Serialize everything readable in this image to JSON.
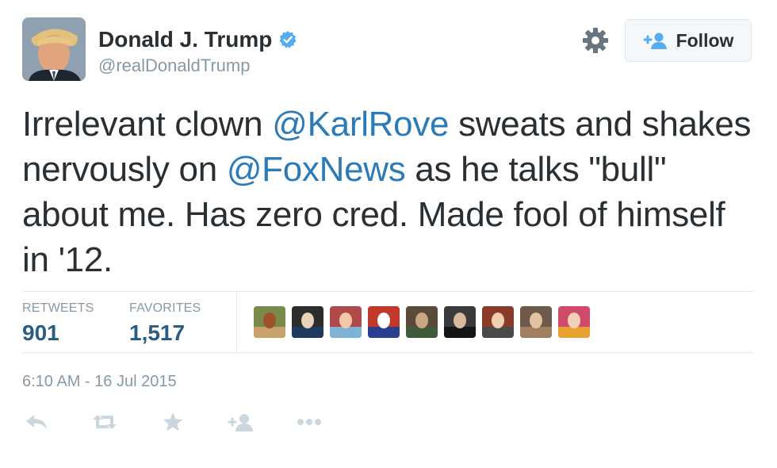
{
  "user": {
    "display_name": "Donald J. Trump",
    "handle": "@realDonaldTrump",
    "verified": true,
    "avatar_icon": "profile-photo"
  },
  "header": {
    "follow_label": "Follow",
    "follow_icon": "add-user-icon",
    "settings_icon": "gear-icon"
  },
  "tweet": {
    "segments": [
      {
        "text": "Irrelevant clown ",
        "type": "text"
      },
      {
        "text": "@KarlRove",
        "type": "mention"
      },
      {
        "text": " sweats and shakes nervously on ",
        "type": "text"
      },
      {
        "text": "@FoxNews",
        "type": "mention"
      },
      {
        "text": " as he talks \"bull\" about me. Has zero cred. Made fool of himself in '12.",
        "type": "text"
      }
    ]
  },
  "stats": {
    "retweets_label": "RETWEETS",
    "retweets_value": "901",
    "favorites_label": "FAVORITES",
    "favorites_value": "1,517",
    "favoriter_avatars_count": 9
  },
  "timestamp": "6:10 AM - 16 Jul 2015",
  "actions": [
    "reply-icon",
    "retweet-icon",
    "favorite-icon",
    "follow-icon",
    "more-icon"
  ],
  "colors": {
    "mention": "#2b7bb9",
    "stat_value": "#2a5d84",
    "muted": "#8899a6",
    "verified": "#55acee"
  }
}
